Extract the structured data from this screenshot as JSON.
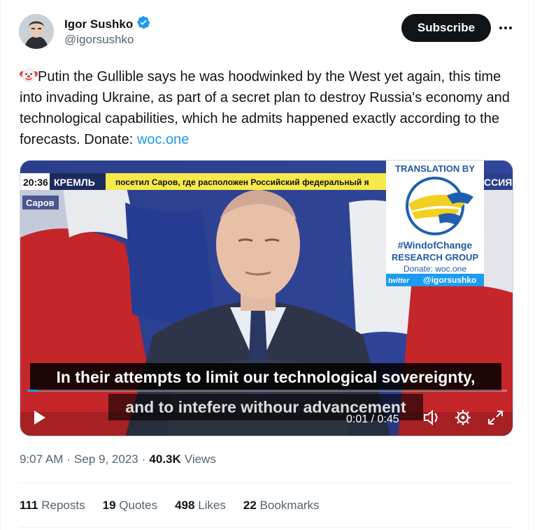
{
  "author": {
    "name": "Igor Sushko",
    "handle": "@igorsushko",
    "verified_color": "#1d9bf0"
  },
  "subscribe_label": "Subscribe",
  "tweet": {
    "text": "Putin the Gullible says he was hoodwinked by the West yet again, this time into invading Ukraine, as part of a secret plan to destroy Russia's economy and technological capabilities, which he admits happened exactly according to the forecasts. Donate: ",
    "link": "woc.one"
  },
  "video": {
    "ticker_time": "20:36",
    "ticker_channel": "КРЕМЛЬ",
    "ticker_text": "посетил Саров, где расположен Российский федеральный я",
    "ticker_right": "ССИЯ",
    "location_tag": "Саров",
    "watermark": {
      "title": "TRANSLATION BY",
      "line1": "#WindofChange",
      "line2": "RESEARCH GROUP",
      "line3": "Donate: woc.one",
      "twitter_word": "twitter",
      "twitter_handle": "@igorsushko"
    },
    "subtitle_line1": "In their attempts to limit our technological sovereignty,",
    "subtitle_line2": "and to intefere withour advancement",
    "time_display": "0:01 / 0:45",
    "progress": 0.022
  },
  "meta": {
    "time": "9:07 AM",
    "date": "Sep 9, 2023",
    "views_count": "40.3K",
    "views_label": "Views"
  },
  "stats": [
    {
      "count": "111",
      "label": "Reposts"
    },
    {
      "count": "19",
      "label": "Quotes"
    },
    {
      "count": "498",
      "label": "Likes"
    },
    {
      "count": "22",
      "label": "Bookmarks"
    }
  ]
}
